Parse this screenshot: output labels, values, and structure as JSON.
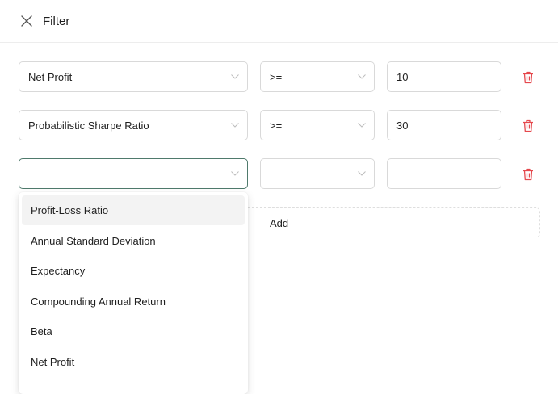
{
  "header": {
    "title": "Filter"
  },
  "filters": [
    {
      "field": "Net Profit",
      "operator": ">=",
      "value": "10"
    },
    {
      "field": "Probabilistic Sharpe Ratio",
      "operator": ">=",
      "value": "30"
    },
    {
      "field": "",
      "operator": "",
      "value": ""
    }
  ],
  "add_button": {
    "label": "Add"
  },
  "dropdown": {
    "options": [
      "Profit-Loss Ratio",
      "Annual Standard Deviation",
      "Expectancy",
      "Compounding Annual Return",
      "Beta",
      "Net Profit"
    ],
    "highlighted": "Profit-Loss Ratio"
  },
  "colors": {
    "delete_icon": "#e5484d",
    "focus_border": "#4f7a6c",
    "border": "#d9d9d9"
  },
  "icons": {
    "close": "close-icon",
    "chevron": "chevron-down-icon",
    "delete": "trash-icon"
  }
}
